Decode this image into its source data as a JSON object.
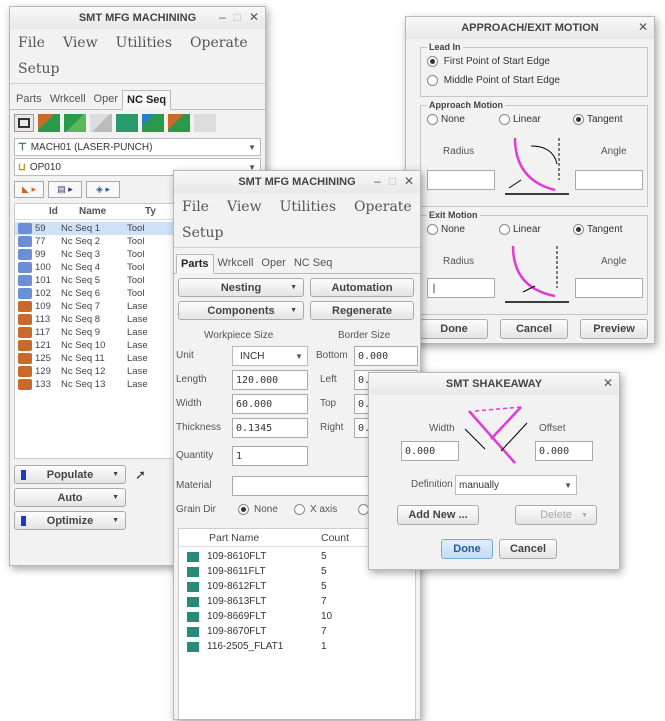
{
  "win1": {
    "title": "SMT MFG MACHINING",
    "menu": [
      "File",
      "View",
      "Utilities",
      "Operate"
    ],
    "setup": "Setup",
    "tabs": [
      "Parts",
      "Wrkcell",
      "Oper",
      "NC Seq"
    ],
    "machine": "MACH01 (LASER-PUNCH)",
    "operation": "OP010",
    "columns": {
      "id": "Id",
      "name": "Name",
      "type": "Ty"
    },
    "rows": [
      {
        "id": "59",
        "name": "Nc Seq 1",
        "type": "Tool"
      },
      {
        "id": "77",
        "name": "Nc Seq 2",
        "type": "Tool"
      },
      {
        "id": "99",
        "name": "Nc Seq 3",
        "type": "Tool"
      },
      {
        "id": "100",
        "name": "Nc Seq 4",
        "type": "Tool"
      },
      {
        "id": "101",
        "name": "Nc Seq 5",
        "type": "Tool"
      },
      {
        "id": "102",
        "name": "Nc Seq 6",
        "type": "Tool"
      },
      {
        "id": "109",
        "name": "Nc Seq 7",
        "type": "Lase"
      },
      {
        "id": "113",
        "name": "Nc Seq 8",
        "type": "Lase"
      },
      {
        "id": "117",
        "name": "Nc Seq 9",
        "type": "Lase"
      },
      {
        "id": "121",
        "name": "Nc Seq 10",
        "type": "Lase"
      },
      {
        "id": "125",
        "name": "Nc Seq 11",
        "type": "Lase"
      },
      {
        "id": "129",
        "name": "Nc Seq 12",
        "type": "Lase"
      },
      {
        "id": "133",
        "name": "Nc Seq 13",
        "type": "Lase"
      }
    ],
    "populate": "Populate",
    "auto": "Auto",
    "optimize": "Optimize"
  },
  "win2": {
    "title": "SMT MFG MACHINING",
    "menu": [
      "File",
      "View",
      "Utilities",
      "Operate"
    ],
    "setup": "Setup",
    "tabs": [
      "Parts",
      "Wrkcell",
      "Oper",
      "NC Seq"
    ],
    "nesting": "Nesting",
    "automation": "Automation",
    "components": "Components",
    "regenerate": "Regenerate",
    "workpiece_size": "Workpiece Size",
    "border_size": "Border Size",
    "unit_label": "Unit",
    "unit_value": "INCH",
    "length_label": "Length",
    "length_value": "120.000",
    "width_label": "Width",
    "width_value": "60.000",
    "thickness_label": "Thickness",
    "thickness_value": "0.1345",
    "bottom_label": "Bottom",
    "bottom_value": "0.000",
    "left_label": "Left",
    "left_value": "0.",
    "top_label": "Top",
    "top_value": "0.",
    "right_label": "Right",
    "right_value": "0.",
    "quantity_label": "Quantity",
    "quantity_value": "1",
    "material_label": "Material",
    "grain_label": "Grain Dir",
    "grain_none": "None",
    "grain_x": "X axis",
    "part_name_header": "Part Name",
    "count_header": "Count",
    "parts": [
      {
        "name": "109-8610FLT",
        "count": "5"
      },
      {
        "name": "109-8611FLT",
        "count": "5"
      },
      {
        "name": "109-8612FLT",
        "count": "5"
      },
      {
        "name": "109-8613FLT",
        "count": "7"
      },
      {
        "name": "109-8669FLT",
        "count": "10"
      },
      {
        "name": "109-8670FLT",
        "count": "7"
      },
      {
        "name": "116-2505_FLAT1",
        "count": "1"
      }
    ]
  },
  "win3": {
    "title": "APPROACH/EXIT MOTION",
    "lead_in": "Lead In",
    "first_point": "First Point of Start Edge",
    "middle_point": "Middle Point of Start Edge",
    "approach_motion": "Approach Motion",
    "exit_motion": "Exit Motion",
    "none": "None",
    "linear": "Linear",
    "tangent": "Tangent",
    "radius": "Radius",
    "angle": "Angle",
    "done": "Done",
    "cancel": "Cancel",
    "preview": "Preview"
  },
  "win4": {
    "title": "SMT SHAKEAWAY",
    "width": "Width",
    "offset": "Offset",
    "width_value": "0.000",
    "offset_value": "0.000",
    "definition_label": "Definition",
    "definition_value": "manually",
    "add_new": "Add New ...",
    "delete": "Delete",
    "done": "Done",
    "cancel": "Cancel"
  },
  "colors": {
    "accent": "#e23ad6",
    "tool_icon": "#6b8fd6",
    "laser_icon": "#c96a2a",
    "part_icon": "#2a8a7a"
  }
}
